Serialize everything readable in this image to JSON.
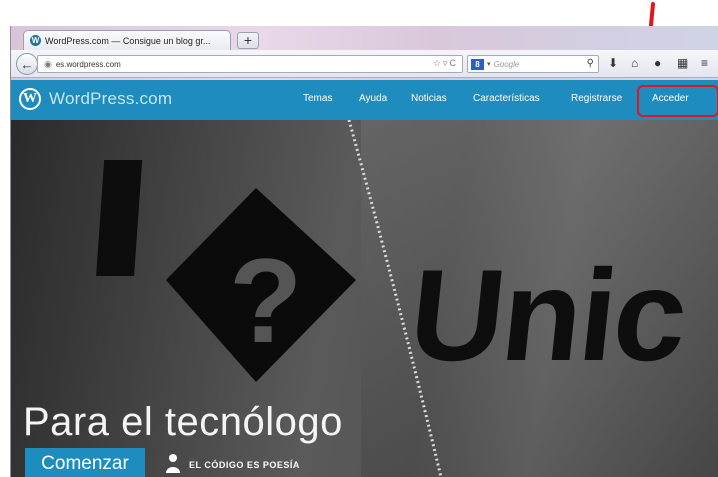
{
  "browser": {
    "tab_title": "WordPress.com — Consigue un blog gr...",
    "new_tab": "+",
    "url": "es.wordpress.com",
    "search_engine": "8",
    "search_placeholder": "Google"
  },
  "site": {
    "brand": "WordPress.com",
    "logo_letter": "W",
    "menu": [
      "Temas",
      "Ayuda",
      "Noticias",
      "Características",
      "Registrarse",
      "Acceder"
    ]
  },
  "hero": {
    "title": "Para el tecnólogo",
    "button": "Comenzar",
    "author": "EL CÓDIGO ES POESÍA",
    "shirt_text": "Unic"
  },
  "colors": {
    "wp_blue": "#1e8cbe",
    "annotation_red": "#e2161b"
  }
}
